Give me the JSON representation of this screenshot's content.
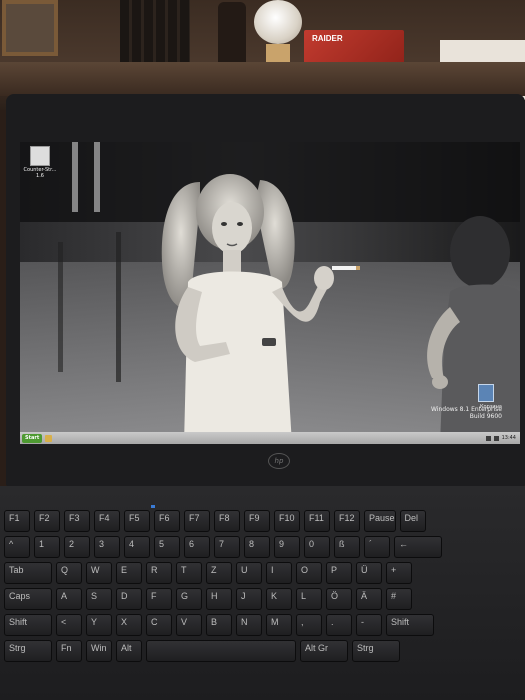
{
  "scene": {
    "box_brand": "RAIDER"
  },
  "desktop": {
    "icons": [
      {
        "label": "Counter-Str... 1.6",
        "icon": "game-shortcut-icon"
      }
    ],
    "recycle_bin_label": "Корзина",
    "watermark_line1": "Windows 8.1 Enterprise",
    "watermark_line2": "Build 9600"
  },
  "taskbar": {
    "start_label": "Start",
    "clock": "13:44"
  },
  "laptop": {
    "brand": "hp"
  },
  "keyboard": {
    "rows": [
      [
        "F1",
        "F2",
        "F3",
        "F4",
        "F5",
        "F6",
        "F7",
        "F8",
        "F9",
        "F10",
        "F11",
        "F12",
        "Pause",
        "Del"
      ],
      [
        "^",
        "1",
        "2",
        "3",
        "4",
        "5",
        "6",
        "7",
        "8",
        "9",
        "0",
        "ß",
        "´",
        "←"
      ],
      [
        "Tab",
        "Q",
        "W",
        "E",
        "R",
        "T",
        "Z",
        "U",
        "I",
        "O",
        "P",
        "Ü",
        "+"
      ],
      [
        "Caps",
        "A",
        "S",
        "D",
        "F",
        "G",
        "H",
        "J",
        "K",
        "L",
        "Ö",
        "Ä",
        "#"
      ],
      [
        "Shift",
        "<",
        "Y",
        "X",
        "C",
        "V",
        "B",
        "N",
        "M",
        ",",
        ".",
        "-",
        "Shift"
      ],
      [
        "Strg",
        "Fn",
        "Win",
        "Alt",
        "",
        "Alt Gr",
        "Strg"
      ]
    ]
  },
  "colors": {
    "taskbar_bg": "#b8b8b8",
    "start_button": "#4e9a32",
    "keyboard_led": "#3a7bd5"
  }
}
